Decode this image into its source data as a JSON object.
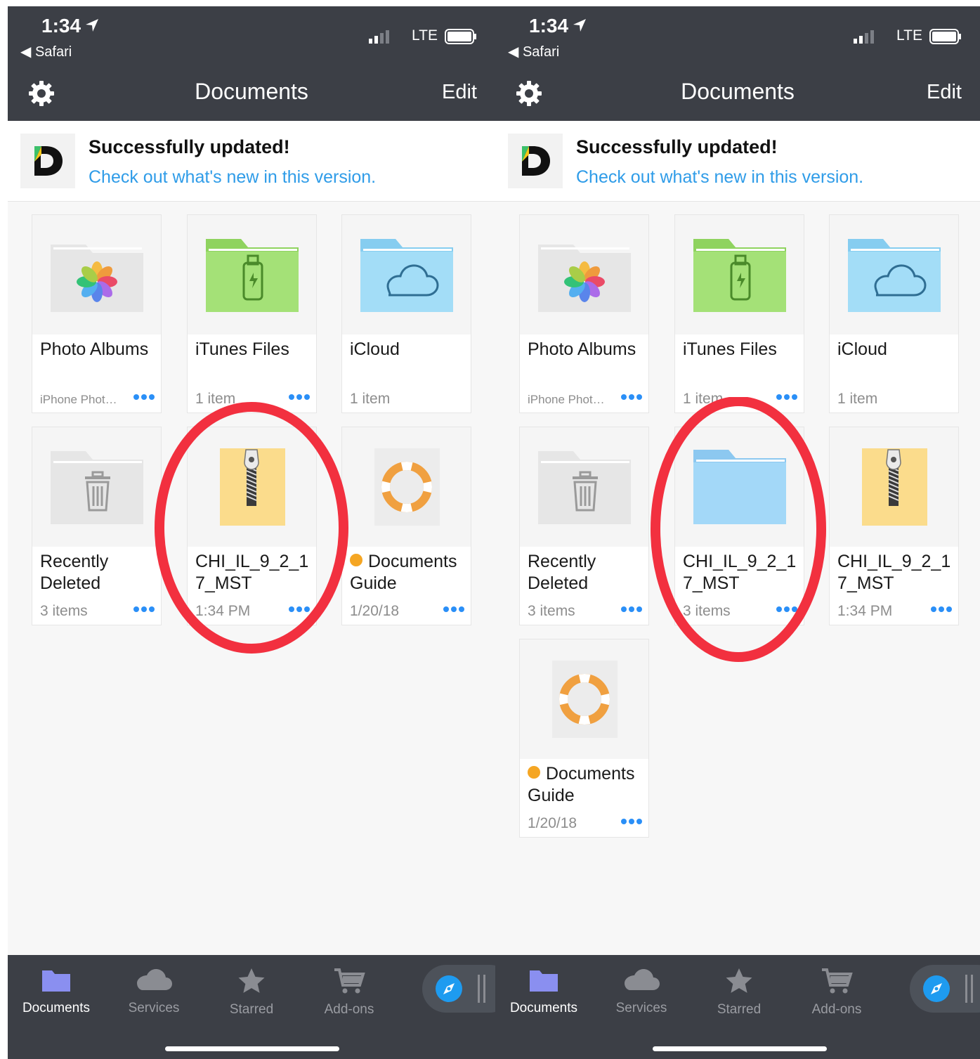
{
  "screens": [
    {
      "status": {
        "time": "1:34",
        "back_app": "Safari",
        "network": "LTE"
      },
      "nav": {
        "title": "Documents",
        "edit_label": "Edit"
      },
      "banner": {
        "title": "Successfully updated!",
        "link": "Check out what's new in this version."
      },
      "items": [
        {
          "name": "Photo Albums",
          "meta": "iPhone Phot…",
          "icon": "photos-folder-icon"
        },
        {
          "name": "iTunes Files",
          "meta": "1 item",
          "icon": "itunes-folder-icon"
        },
        {
          "name": "iCloud",
          "meta": "1 item",
          "icon": "icloud-folder-icon"
        },
        {
          "name": "Recently Deleted",
          "meta": "3 items",
          "icon": "trash-folder-icon"
        },
        {
          "name": "CHI_IL_9_2_17_MST",
          "meta": "1:34 PM",
          "icon": "zip-file-icon"
        },
        {
          "name": "Documents Guide",
          "meta": "1/20/18",
          "icon": "lifebuoy-icon"
        }
      ],
      "tabs": [
        {
          "label": "Documents",
          "icon": "folder-icon"
        },
        {
          "label": "Services",
          "icon": "cloud-icon"
        },
        {
          "label": "Starred",
          "icon": "star-icon"
        },
        {
          "label": "Add-ons",
          "icon": "cart-icon"
        }
      ]
    },
    {
      "status": {
        "time": "1:34",
        "back_app": "Safari",
        "network": "LTE"
      },
      "nav": {
        "title": "Documents",
        "edit_label": "Edit"
      },
      "banner": {
        "title": "Successfully updated!",
        "link": "Check out what's new in this version."
      },
      "items": [
        {
          "name": "Photo Albums",
          "meta": "iPhone Phot…",
          "icon": "photos-folder-icon"
        },
        {
          "name": "iTunes Files",
          "meta": "1 item",
          "icon": "itunes-folder-icon"
        },
        {
          "name": "iCloud",
          "meta": "1 item",
          "icon": "icloud-folder-icon"
        },
        {
          "name": "Recently Deleted",
          "meta": "3 items",
          "icon": "trash-folder-icon"
        },
        {
          "name": "CHI_IL_9_2_17_MST",
          "meta": "3 items",
          "icon": "blue-folder-icon"
        },
        {
          "name": "CHI_IL_9_2_17_MST",
          "meta": "1:34 PM",
          "icon": "zip-file-icon"
        },
        {
          "name": "Documents Guide",
          "meta": "1/20/18",
          "icon": "lifebuoy-icon"
        }
      ],
      "tabs": [
        {
          "label": "Documents",
          "icon": "folder-icon"
        },
        {
          "label": "Services",
          "icon": "cloud-icon"
        },
        {
          "label": "Starred",
          "icon": "star-icon"
        },
        {
          "label": "Add-ons",
          "icon": "cart-icon"
        }
      ]
    }
  ],
  "colors": {
    "header": "#3c3f46",
    "link": "#2f9ce8",
    "highlight": "#f2303f",
    "accent_dots": "#2a8ff7"
  }
}
